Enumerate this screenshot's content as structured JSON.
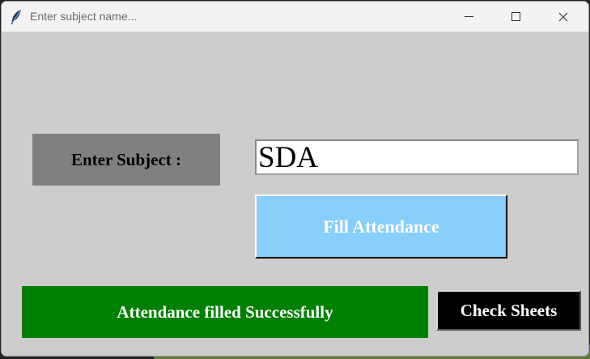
{
  "window": {
    "title": "Enter subject name...",
    "app_icon": "feather-icon",
    "controls": {
      "minimize_icon": "minimize-icon",
      "maximize_icon": "maximize-icon",
      "close_icon": "close-icon"
    }
  },
  "form": {
    "subject_label": "Enter Subject :",
    "subject_value": "SDA",
    "fill_button_label": "Fill Attendance",
    "status_message": "Attendance filled Successfully",
    "check_button_label": "Check Sheets"
  },
  "colors": {
    "window_bg": "#cdcdcd",
    "label_bg": "#808080",
    "fill_button_bg": "#87cefa",
    "status_bg": "#008000",
    "check_button_bg": "#000000"
  }
}
